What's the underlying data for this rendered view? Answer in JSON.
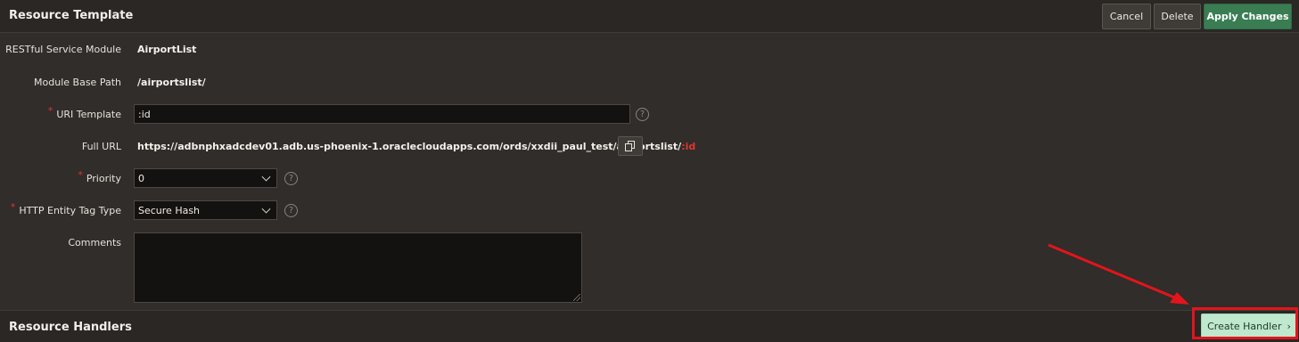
{
  "header": {
    "title": "Resource Template",
    "buttons": {
      "cancel": "Cancel",
      "delete": "Delete",
      "apply": "Apply Changes"
    }
  },
  "form": {
    "module_label": "RESTful Service Module",
    "module_value": "AirportList",
    "base_path_label": "Module Base Path",
    "base_path_value": "/airportslist/",
    "uri_template_label": "URI Template",
    "uri_template_value": ":id",
    "full_url_label": "Full URL",
    "full_url_base": "https://adbnphxadcdev01.adb.us-phoenix-1.oraclecloudapps.com/ords/xxdii_paul_test/airportslist/",
    "full_url_param": ":id",
    "priority_label": "Priority",
    "priority_value": "0",
    "etag_label": "HTTP Entity Tag Type",
    "etag_value": "Secure Hash",
    "comments_label": "Comments",
    "comments_value": "",
    "required_marker": "*",
    "help_glyph": "?"
  },
  "handlers": {
    "title": "Resource Handlers",
    "create_label": "Create Handler",
    "create_chevron": "›"
  },
  "icons": {
    "copy": "copy-icon",
    "help": "help-icon",
    "chevron": "chevron-down-icon"
  },
  "colors": {
    "accent_red": "#e3141c",
    "primary_green": "#3a7d53",
    "create_green": "#bfe8cf"
  }
}
